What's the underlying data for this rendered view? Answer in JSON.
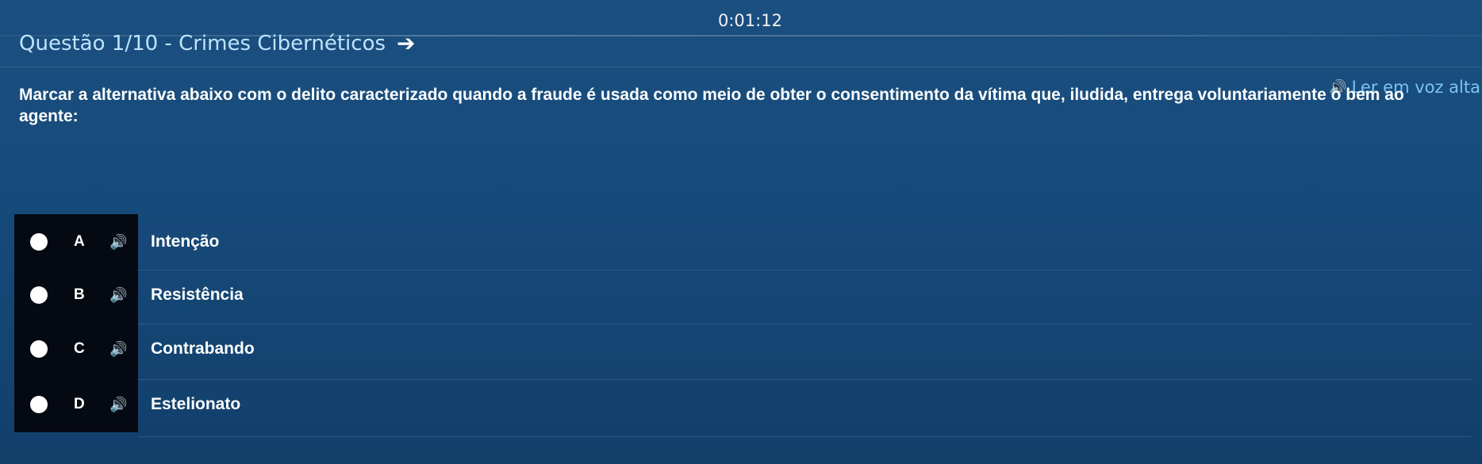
{
  "timer": "0:01:12",
  "question_header": {
    "title": "Questão 1/10 - Crimes Cibernéticos",
    "next_icon": "arrow-right-icon"
  },
  "read_aloud": {
    "icon": "speaker-icon",
    "label": "Ler em voz alta"
  },
  "question_text": "Marcar a alternativa abaixo com o delito caracterizado quando a fraude é usada como meio de obter o consentimento da vítima que, iludida, entrega voluntariamente o bem ao agente:",
  "options": [
    {
      "letter": "A",
      "text": "Intenção"
    },
    {
      "letter": "B",
      "text": "Resistência"
    },
    {
      "letter": "C",
      "text": "Contrabando"
    },
    {
      "letter": "D",
      "text": "Estelionato"
    }
  ],
  "colors": {
    "background": "#164a7a",
    "title": "#bfe3ff",
    "read_aloud": "#7cc2f7",
    "option_panel": "#050a12"
  }
}
